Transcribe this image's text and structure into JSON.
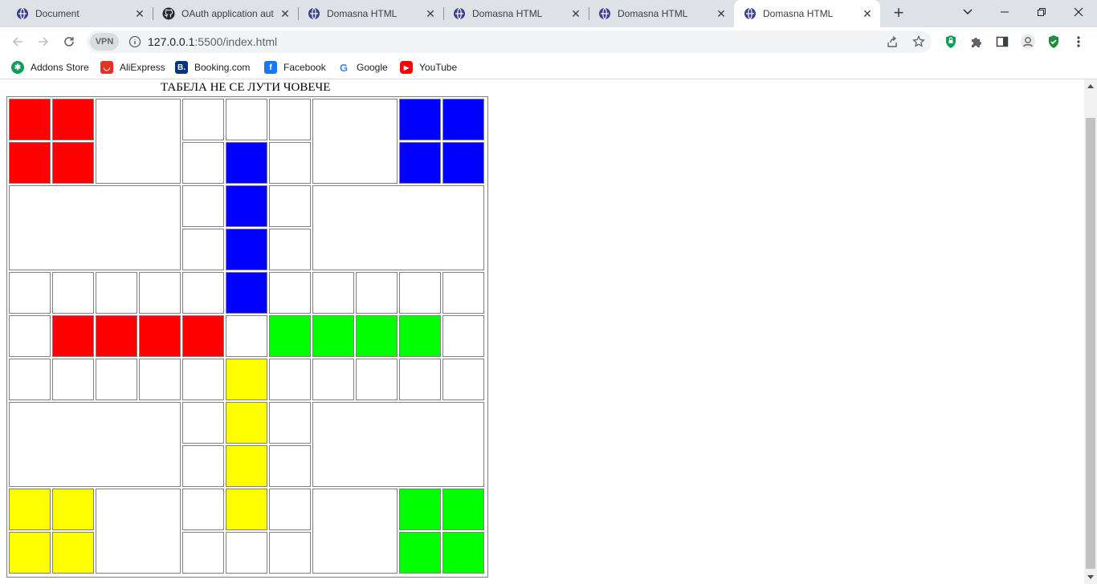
{
  "tabs": [
    {
      "title": "Document",
      "favicon": "globe-icon"
    },
    {
      "title": "OAuth application aut",
      "favicon": "github-icon"
    },
    {
      "title": "Domasna HTML",
      "favicon": "globe-icon"
    },
    {
      "title": "Domasna HTML",
      "favicon": "globe-icon"
    },
    {
      "title": "Domasna HTML",
      "favicon": "globe-icon"
    },
    {
      "title": "Domasna HTML",
      "favicon": "globe-icon",
      "active": true
    }
  ],
  "toolbar": {
    "vpn_label": "VPN",
    "url_host": "127.0.0.1",
    "url_rest": ":5500/index.html"
  },
  "bookmarks": [
    {
      "label": "Addons Store",
      "icon": "addons-icon",
      "color": "#0f9d58"
    },
    {
      "label": "AliExpress",
      "icon": "aliexpress-icon",
      "color": "#e43225"
    },
    {
      "label": "Booking.com",
      "icon": "booking-icon",
      "color": "#003580"
    },
    {
      "label": "Facebook",
      "icon": "facebook-icon",
      "color": "#1877f2"
    },
    {
      "label": "Google",
      "icon": "google-icon",
      "color": "#4285f4"
    },
    {
      "label": "YouTube",
      "icon": "youtube-icon",
      "color": "#ff0000"
    }
  ],
  "page": {
    "title": "ТАБЕЛА НЕ СЕ ЛУТИ ЧОВЕЧЕ"
  },
  "colors": {
    "red": "#ff0000",
    "blue": "#0000ff",
    "green": "#00ff00",
    "yellow": "#ffff00",
    "white": "#ffffff"
  },
  "board": {
    "grid": [
      [
        "red",
        "red",
        "*",
        "*",
        "white",
        "white",
        "white",
        "*",
        "*",
        "blue",
        "blue"
      ],
      [
        "red",
        "red",
        "*",
        "*",
        "white",
        "blue",
        "white",
        "*",
        "*",
        "blue",
        "blue"
      ],
      [
        "*",
        "*",
        "*",
        "*",
        "white",
        "blue",
        "white",
        "*",
        "*",
        "*",
        "*"
      ],
      [
        "*",
        "*",
        "*",
        "*",
        "white",
        "blue",
        "white",
        "*",
        "*",
        "*",
        "*"
      ],
      [
        "white",
        "white",
        "white",
        "white",
        "white",
        "blue",
        "white",
        "white",
        "white",
        "white",
        "white"
      ],
      [
        "white",
        "red",
        "red",
        "red",
        "red",
        "white",
        "green",
        "green",
        "green",
        "green",
        "white"
      ],
      [
        "white",
        "white",
        "white",
        "white",
        "white",
        "yellow",
        "white",
        "white",
        "white",
        "white",
        "white"
      ],
      [
        "*",
        "*",
        "*",
        "*",
        "white",
        "yellow",
        "white",
        "*",
        "*",
        "*",
        "*"
      ],
      [
        "*",
        "*",
        "*",
        "*",
        "white",
        "yellow",
        "white",
        "*",
        "*",
        "*",
        "*"
      ],
      [
        "yellow",
        "yellow",
        "*",
        "*",
        "white",
        "yellow",
        "white",
        "*",
        "*",
        "green",
        "green"
      ],
      [
        "yellow",
        "yellow",
        "*",
        "*",
        "white",
        "white",
        "white",
        "*",
        "*",
        "green",
        "green"
      ]
    ],
    "merged": [
      {
        "row": 0,
        "col": 2,
        "type": "2x2"
      },
      {
        "row": 0,
        "col": 7,
        "type": "2x2"
      },
      {
        "row": 2,
        "col": 0,
        "type": "4x2"
      },
      {
        "row": 2,
        "col": 7,
        "type": "4x2"
      },
      {
        "row": 7,
        "col": 0,
        "type": "4x2"
      },
      {
        "row": 7,
        "col": 7,
        "type": "4x2"
      },
      {
        "row": 9,
        "col": 2,
        "type": "2x2"
      },
      {
        "row": 9,
        "col": 7,
        "type": "2x2"
      }
    ]
  }
}
